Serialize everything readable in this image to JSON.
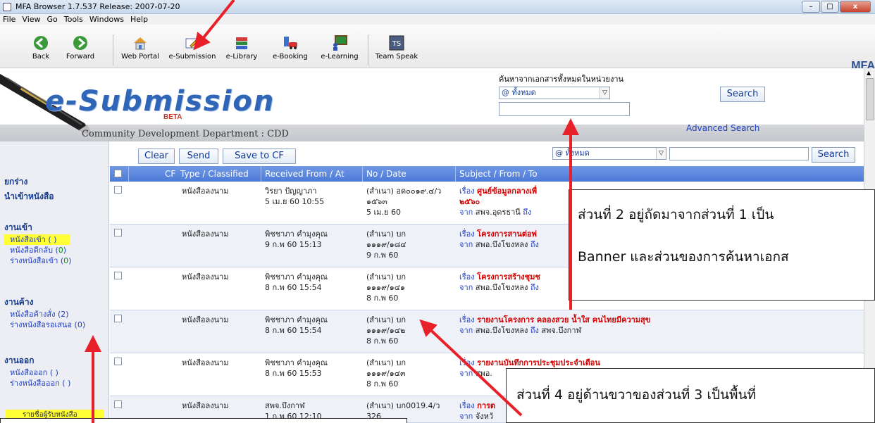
{
  "window": {
    "title": "MFA Browser 1.7.537  Release: 2007-07-20",
    "minimize": "–",
    "maximize": "□",
    "close": "x"
  },
  "menu": [
    "File",
    "View",
    "Go",
    "Tools",
    "Windows",
    "Help"
  ],
  "toolbar": {
    "items": [
      {
        "label": "Back",
        "icon": "back-arrow-icon"
      },
      {
        "label": "Forward",
        "icon": "forward-arrow-icon"
      },
      {
        "label": "Web Portal",
        "icon": "home-icon"
      },
      {
        "label": "e-Submission",
        "icon": "document-pencil-icon"
      },
      {
        "label": "e-Library",
        "icon": "books-icon"
      },
      {
        "label": "e-Booking",
        "icon": "car-booking-icon"
      },
      {
        "label": "e-Learning",
        "icon": "board-learning-icon"
      },
      {
        "label": "Team Speak",
        "icon": "teamspeak-icon"
      }
    ],
    "brand_logo_text": "MFA",
    "teamspeak_text": "TS"
  },
  "banner": {
    "brand": "e-Submission",
    "beta": "BETA",
    "department": "Community Development Department : CDD",
    "search_title": "ค้นหาจากเอกสารทั้งหมดในหน่วยงาน",
    "scope_selected": "@ ทั้งหมด",
    "search_button": "Search",
    "advanced_search": "Advanced Search",
    "dropdown_glyph": "▽"
  },
  "actions": {
    "clear": "Clear",
    "send": "Send",
    "save": "Save to CF",
    "scope_selected": "@ ทั้งหมด",
    "search_button": "Search"
  },
  "sidebar": {
    "draft": "ยกร่าง",
    "import": "นำเข้าหนังสือ",
    "incoming_head": "งานเข้า",
    "incoming_items": [
      {
        "label": "หนังสือเข้า ( ",
        "count": "",
        "suffix": " )"
      },
      {
        "label": "หนังสือตีกลับ (",
        "count": "0",
        "suffix": ")"
      },
      {
        "label": "ร่างหนังสือเข้า (",
        "count": "0",
        "suffix": ")"
      }
    ],
    "pending_head": "งานค้าง",
    "pending_items": [
      {
        "label": "หนังสือค้างสั่ง (2)"
      },
      {
        "label": "ร่างหนังสือรอเสนอ (0)"
      }
    ],
    "outgoing_head": "งานออก",
    "outgoing_items": [
      {
        "label": "หนังสือออก ( )"
      },
      {
        "label": "ร่างหนังสือออก ( )"
      }
    ],
    "bottom_bar": "รายชื่อผู้รับหนังสือ"
  },
  "table": {
    "headers": {
      "cf": "CF",
      "type": "Type / Classified",
      "received": "Received From / At",
      "no_date": "No / Date",
      "subject": "Subject / From / To"
    },
    "subject_key": "เรื่อง",
    "from_key": "จาก",
    "to_key": "ถึง",
    "rows": [
      {
        "type": "หนังสือลงนาม",
        "from_name": "วิรยา  ปัญญาภา",
        "from_at": "5 เม.ย  60 10:55",
        "no1": "(สำเนา) อด๐๐๑๙.๔/ว",
        "no2": "๑๕๖๓",
        "date": "5 เม.ย  60",
        "subject": "ศูนย์ข้อมูลกลางเพื่",
        "subject2": "๒๕๖๐",
        "from_org": "สพจ.อุดรธานี",
        "to_org": ""
      },
      {
        "type": "หนังสือลงนาม",
        "from_name": "พิชชาภา  คำมุงคุณ",
        "from_at": "9 ก.พ  60 15:13",
        "no1": "(สำเนา) บก",
        "no2": "๑๑๑๙/๑๘๔",
        "date": "9 ก.พ  60",
        "subject": "โครงการสานต่อพ่",
        "subject2": "",
        "from_org": "สพอ.บึงโขงหลง",
        "to_org": ""
      },
      {
        "type": "หนังสือลงนาม",
        "from_name": "พิชชาภา  คำมุงคุณ",
        "from_at": "8 ก.พ  60 15:54",
        "no1": "(สำเนา) บก",
        "no2": "๑๑๑๙/๑๔๑",
        "date": "8 ก.พ  60",
        "subject": "โครงการสร้างชุมช",
        "subject2": "",
        "from_org": "สพอ.บึงโขงหลง",
        "to_org": ""
      },
      {
        "type": "หนังสือลงนาม",
        "from_name": "พิชชาภา  คำมุงคุณ",
        "from_at": "8 ก.พ  60 15:54",
        "no1": "(สำเนา) บก",
        "no2": "๑๑๑๙/๑๔๒",
        "date": "8 ก.พ  60",
        "subject": "รายงานโครงการ  คลองสวย  น้ำใส  คนไทยมีความสุข",
        "subject2": "",
        "from_org": "สพอ.บึงโขงหลง",
        "to_org": "สพจ.บึงกาฬ"
      },
      {
        "type": "หนังสือลงนาม",
        "from_name": "พิชชาภา  คำมุงคุณ",
        "from_at": "8 ก.พ  60 15:53",
        "no1": "(สำเนา) บก",
        "no2": "๑๑๑๙/๑๔๓",
        "date": "8 ก.พ  60",
        "subject": "รายงานบันทึกการประชุมประจำเดือน",
        "subject2": "",
        "from_org": "สพอ.",
        "to_org": ""
      },
      {
        "type": "หนังสือลงนาม",
        "from_name": "สพจ.บึงกาฬ",
        "from_at": "1 ก.พ  60 12:10",
        "no1": "(สำเนา) บก0019.4/ว",
        "no2": "326",
        "date": "",
        "subject": "การต",
        "subject2": "",
        "from_org": "จังหวั",
        "to_org": ""
      }
    ]
  },
  "annotations": {
    "part2_line1": "ส่วนที่ 2 อยู่ถัดมาจากส่วนที่ 1 เป็น",
    "part2_line2": "Banner และส่วนของการค้นหาเอกส",
    "part4_line1": "ส่วนที่ 4 อยู่ด้านขวาของส่วนที่ 3 เป็นพื้นที่"
  },
  "colors": {
    "arrow": "#e8202a",
    "header_blue": "#5580dc",
    "subject_red": "#d40000",
    "link_blue": "#1f3fc6",
    "highlight_yellow": "#ffff33"
  }
}
